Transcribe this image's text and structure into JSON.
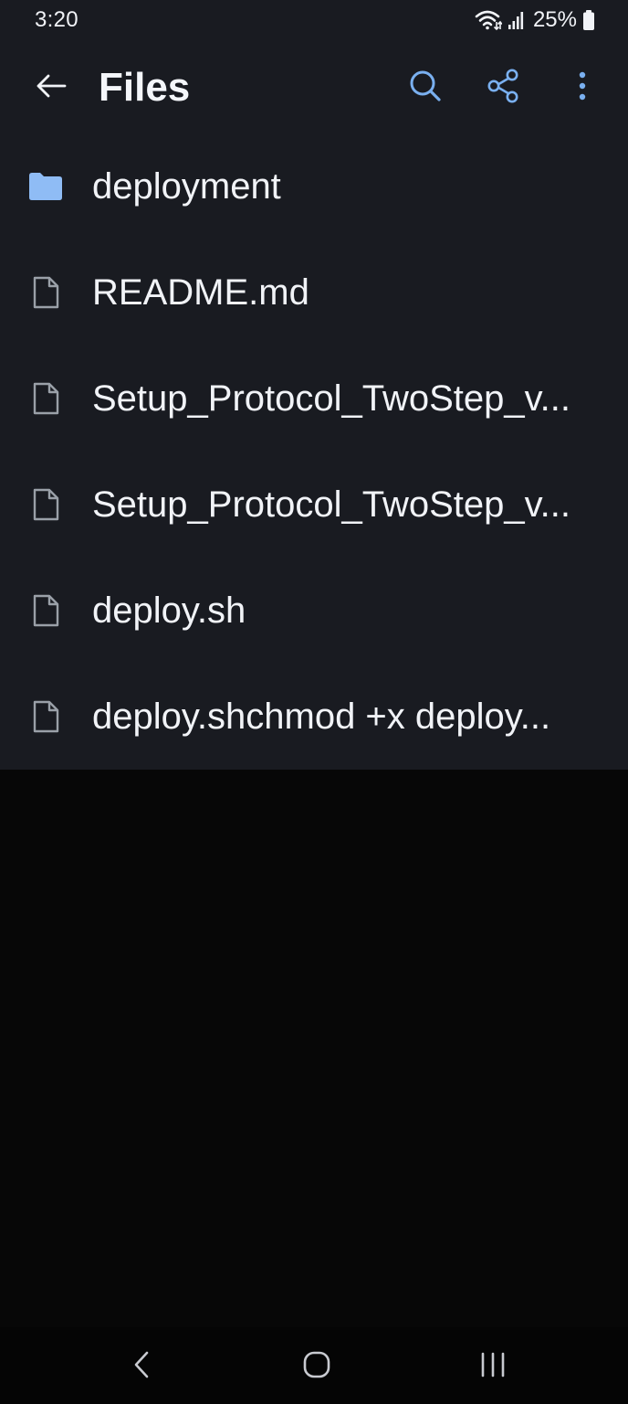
{
  "status_bar": {
    "time": "3:20",
    "battery": "25%",
    "icons": [
      "wifi-icon",
      "signal-icon",
      "battery-icon"
    ]
  },
  "app_bar": {
    "title": "Files",
    "back_icon": "arrow-left-icon",
    "actions": [
      "search-icon",
      "share-icon",
      "more-vert-icon"
    ]
  },
  "files": [
    {
      "name": "deployment",
      "type": "folder",
      "icon": "folder-icon"
    },
    {
      "name": "README.md",
      "type": "file",
      "icon": "file-icon"
    },
    {
      "name": "Setup_Protocol_TwoStep_v...",
      "type": "file",
      "icon": "file-icon"
    },
    {
      "name": "Setup_Protocol_TwoStep_v...",
      "type": "file",
      "icon": "file-icon"
    },
    {
      "name": "deploy.sh",
      "type": "file",
      "icon": "file-icon"
    },
    {
      "name": "deploy.shchmod +x deploy...",
      "type": "file",
      "icon": "file-icon"
    }
  ],
  "nav_bar": {
    "buttons": [
      "nav-back-icon",
      "nav-home-icon",
      "nav-recents-icon"
    ]
  },
  "colors": {
    "app_background": "#191b21",
    "empty_background": "#070707",
    "accent": "#7ab0f0",
    "folder": "#8fbcf5",
    "file_icon": "#9aa0a8",
    "text": "#f1f3f7"
  }
}
